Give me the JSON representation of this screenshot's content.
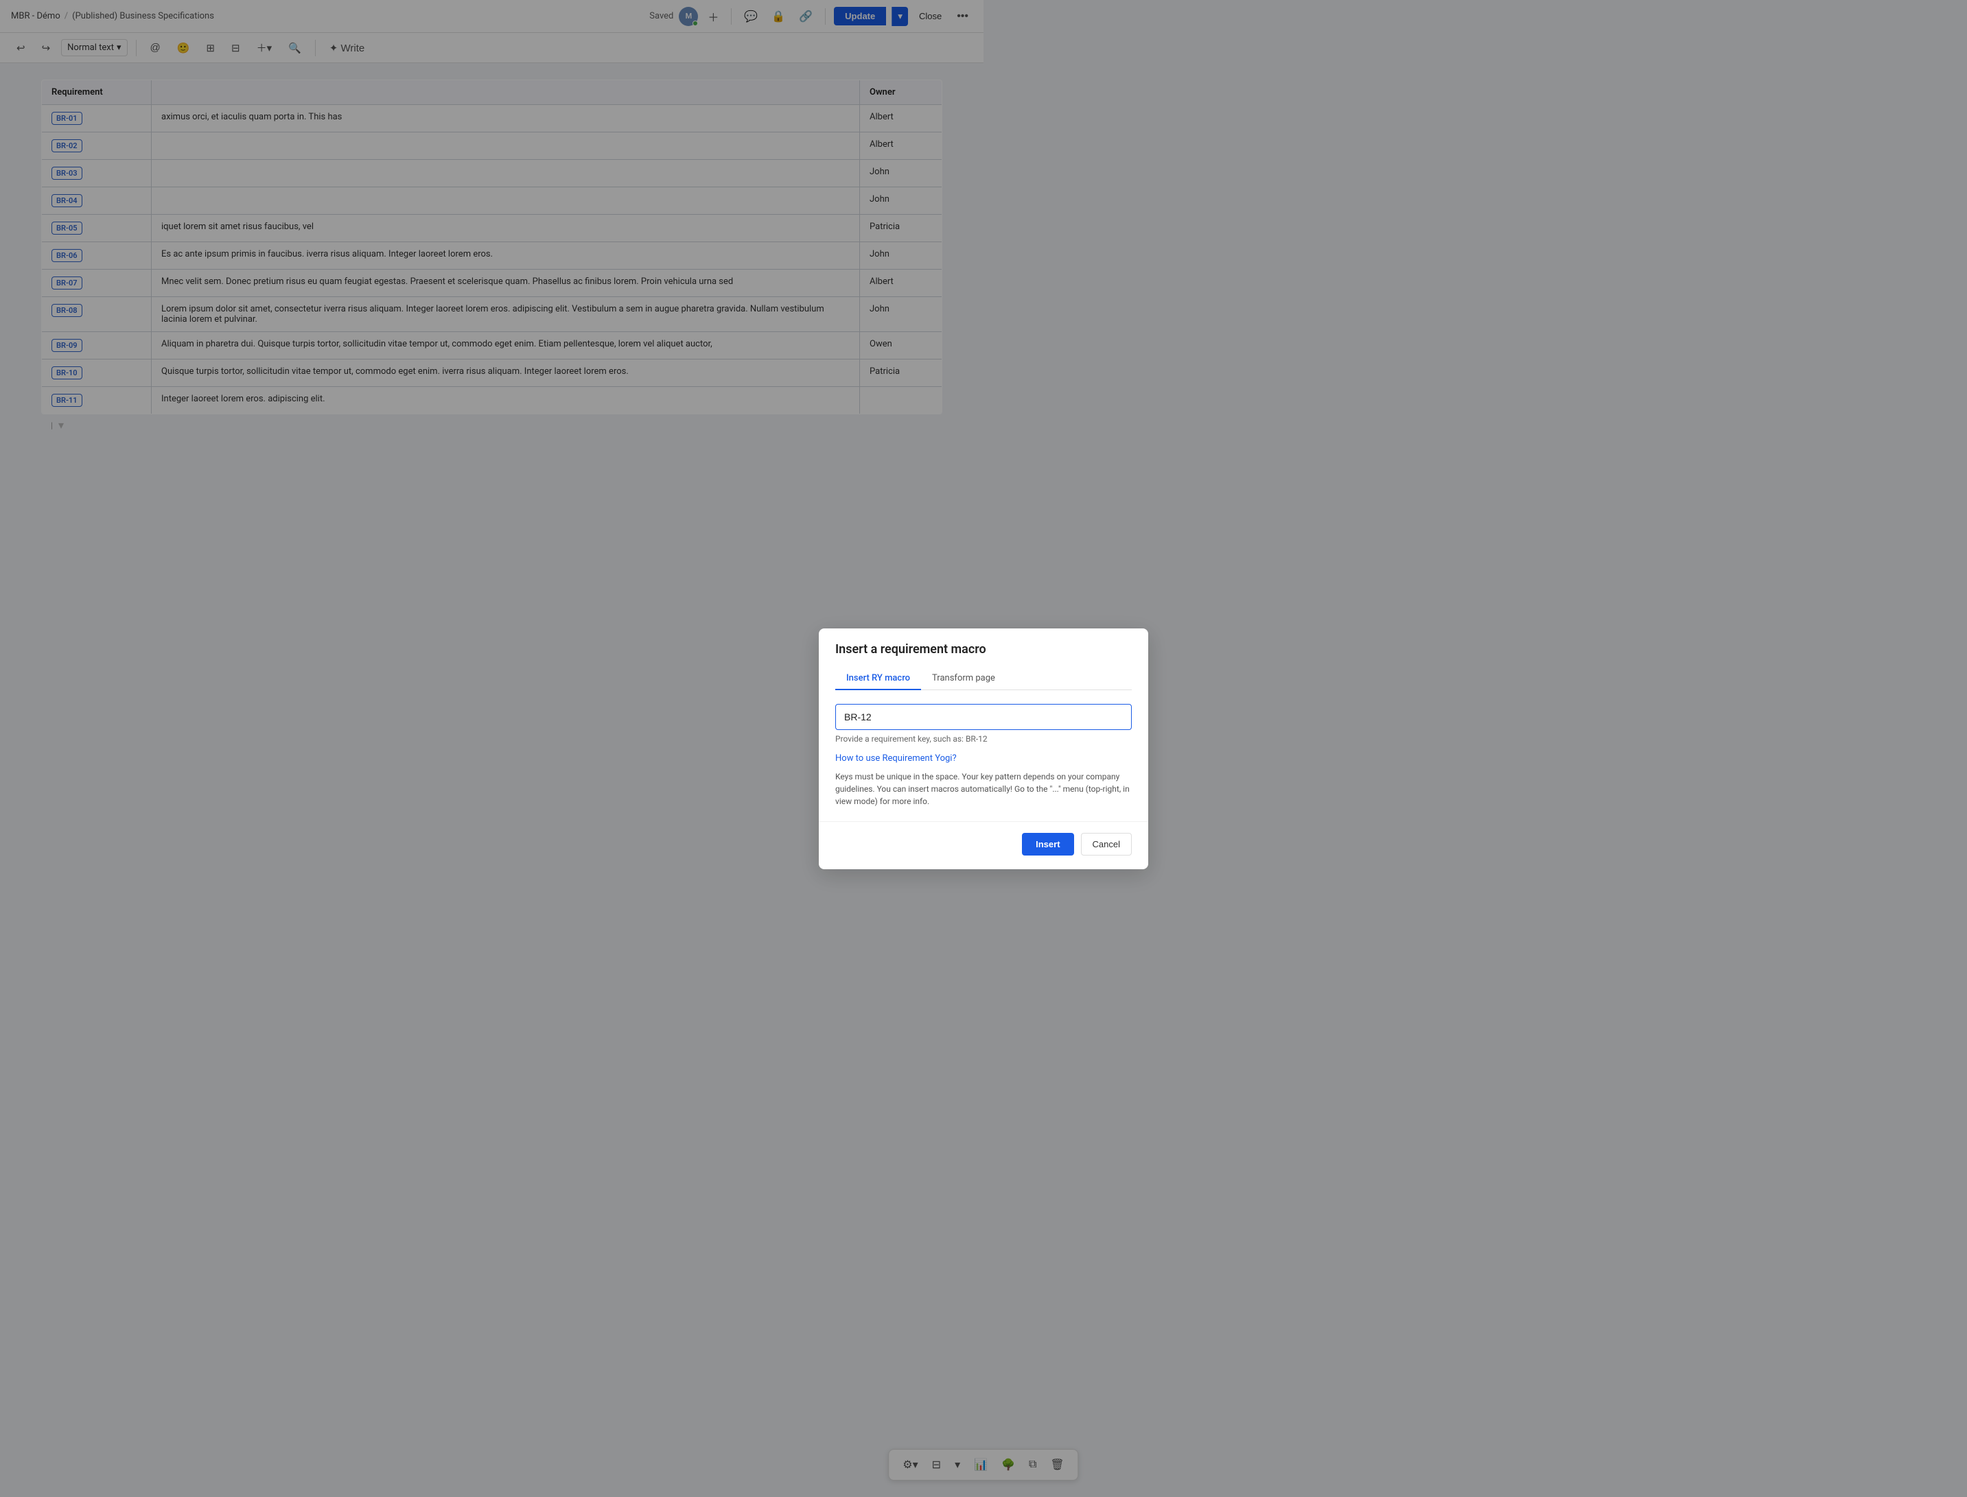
{
  "topNav": {
    "breadcrumb1": "MBR - Démo",
    "separator": "/",
    "breadcrumb2": "(Published) Business Specifications",
    "savedText": "Saved",
    "updateLabel": "Update",
    "closeLabel": "Close",
    "avatarInitials": "M"
  },
  "toolbar": {
    "undoLabel": "↩",
    "redoLabel": "↪",
    "textStyleLabel": "Normal text",
    "dropdownArrow": "▾"
  },
  "modal": {
    "title": "Insert a requirement macro",
    "tab1": "Insert RY macro",
    "tab2": "Transform page",
    "inputValue": "BR-12",
    "inputPlaceholder": "BR-12",
    "hint": "Provide a requirement key, such as:  BR-12",
    "linkText": "How to use Requirement Yogi?",
    "info": "Keys must be unique in the space. Your key pattern depends on your company guidelines. You can insert macros automatically! Go to the \"...\" menu (top-right, in view mode) for more info.",
    "insertBtn": "Insert",
    "cancelBtn": "Cancel"
  },
  "table": {
    "col1": "Requirement",
    "col3": "Owner",
    "rows": [
      {
        "id": "BR-01",
        "desc": "aximus orci, et iaculis quam porta in. This has",
        "owner": "Albert"
      },
      {
        "id": "BR-02",
        "desc": "",
        "owner": "Albert"
      },
      {
        "id": "BR-03",
        "desc": "",
        "owner": "John"
      },
      {
        "id": "BR-04",
        "desc": "",
        "owner": "John"
      },
      {
        "id": "BR-05",
        "desc": "iquet lorem sit amet risus faucibus, vel",
        "owner": "Patricia"
      },
      {
        "id": "BR-06",
        "desc": "Es ac ante ipsum primis in faucibus. iverra risus aliquam. Integer laoreet lorem eros.",
        "owner": "John"
      },
      {
        "id": "BR-07",
        "desc": "Mnec velit sem. Donec pretium risus eu quam feugiat egestas. Praesent et scelerisque quam. Phasellus ac finibus lorem. Proin vehicula urna sed",
        "owner": "Albert"
      },
      {
        "id": "BR-08",
        "desc": "Lorem ipsum dolor sit amet, consectetur iverra risus aliquam. Integer laoreet lorem eros. adipiscing elit. Vestibulum a sem in augue pharetra gravida. Nullam vestibulum lacinia lorem et pulvinar.",
        "owner": "John"
      },
      {
        "id": "BR-09",
        "desc": "Aliquam in pharetra dui. Quisque turpis tortor, sollicitudin vitae tempor ut, commodo eget enim. Etiam pellentesque, lorem vel aliquet auctor,",
        "owner": "Owen"
      },
      {
        "id": "BR-10",
        "desc": "Quisque turpis tortor, sollicitudin vitae tempor ut, commodo eget enim. iverra risus aliquam. Integer laoreet lorem eros.",
        "owner": "Patricia"
      },
      {
        "id": "BR-11",
        "desc": "Integer laoreet lorem eros. adipiscing elit.",
        "owner": ""
      }
    ]
  }
}
